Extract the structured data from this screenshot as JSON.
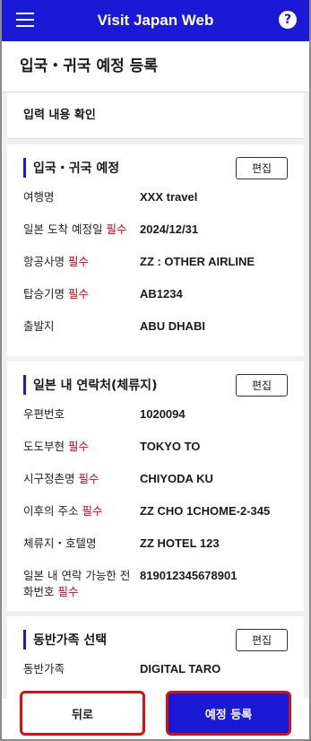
{
  "app": {
    "title": "Visit Japan Web"
  },
  "page_title": "입국・귀국 예정 등록",
  "confirm_label": "입력 내용 확인",
  "required_text": "필수",
  "sections": [
    {
      "title": "입국・귀국 예정",
      "edit_label": "편집",
      "rows": [
        {
          "label": "여행명",
          "required": false,
          "value": "XXX travel"
        },
        {
          "label": "일본 도착 예정일",
          "required": true,
          "value": "2024/12/31"
        },
        {
          "label": "항공사명",
          "required": true,
          "value": "ZZ : OTHER AIRLINE"
        },
        {
          "label": "탑승기명",
          "required": true,
          "value": "AB1234"
        },
        {
          "label": "출발지",
          "required": false,
          "value": "ABU DHABI"
        }
      ]
    },
    {
      "title": "일본 내 연락처(체류지)",
      "edit_label": "편집",
      "rows": [
        {
          "label": "우편번호",
          "required": false,
          "value": "1020094"
        },
        {
          "label": "도도부현",
          "required": true,
          "value": "TOKYO TO"
        },
        {
          "label": "시구정촌명",
          "required": true,
          "value": "CHIYODA KU"
        },
        {
          "label": "이후의 주소",
          "required": true,
          "value": "ZZ CHO 1CHOME-2-345"
        },
        {
          "label": "체류지・호텔명",
          "required": false,
          "value": "ZZ HOTEL 123"
        },
        {
          "label": "일본 내 연락 가능한 전화번호",
          "required": true,
          "value": "819012345678901"
        }
      ]
    },
    {
      "title": "동반가족 선택",
      "edit_label": "편집",
      "rows": [
        {
          "label": "동반가족",
          "required": false,
          "value": "DIGITAL TARO"
        }
      ]
    }
  ],
  "actions": {
    "back_label": "뒤로",
    "submit_label": "예정 등록"
  },
  "colors": {
    "primary": "#1a1ad6",
    "required": "#d4001a",
    "highlight": "#d61010"
  },
  "icons": {
    "menu": "hamburger-menu-icon",
    "help": "help-icon"
  }
}
